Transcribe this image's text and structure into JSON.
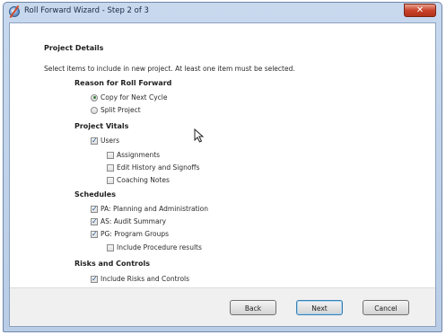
{
  "window": {
    "title": "Roll Forward Wizard - Step 2 of 3",
    "close_glyph": "✕"
  },
  "panel": {
    "heading": "Project Details",
    "instruction": "Select items to include in new project. At least one item must be selected."
  },
  "sections": {
    "reason": {
      "heading": "Reason for Roll Forward",
      "options": [
        {
          "label": "Copy for Next Cycle",
          "selected": true
        },
        {
          "label": "Split Project",
          "selected": false
        }
      ]
    },
    "vitals": {
      "heading": "Project Vitals",
      "users": {
        "label": "Users",
        "checked": true
      },
      "sub": [
        {
          "label": "Assignments",
          "checked": false
        },
        {
          "label": "Edit History and Signoffs",
          "checked": false
        },
        {
          "label": "Coaching Notes",
          "checked": false
        }
      ]
    },
    "schedules": {
      "heading": "Schedules",
      "items": [
        {
          "label": "PA: Planning and Administration",
          "checked": true
        },
        {
          "label": "AS: Audit Summary",
          "checked": true
        },
        {
          "label": "PG: Program Groups",
          "checked": true
        }
      ],
      "procedure": {
        "label": "Include Procedure results",
        "checked": false
      }
    },
    "risks": {
      "heading": "Risks and Controls",
      "include": {
        "label": "Include Risks and Controls",
        "checked": true
      }
    }
  },
  "buttons": {
    "back": "Back",
    "next": "Next",
    "cancel": "Cancel"
  },
  "icons": {
    "check_glyph": "✓",
    "cursor": "mouse-pointer-icon"
  }
}
